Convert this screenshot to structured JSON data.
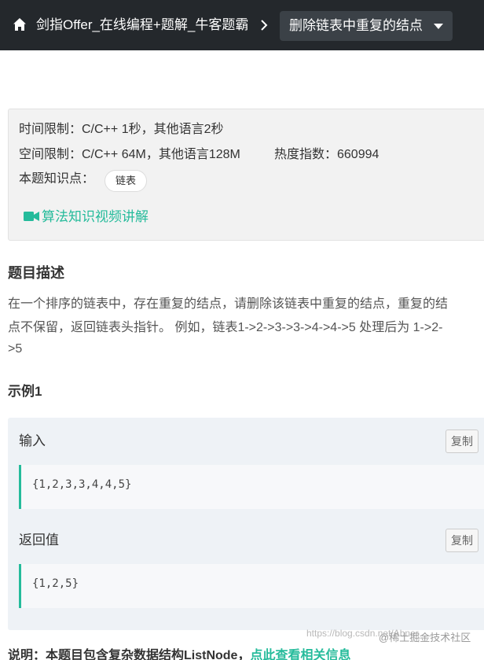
{
  "header": {
    "breadcrumb_link": "剑指Offer_在线编程+题解_牛客题霸",
    "current_problem": "删除链表中重复的结点"
  },
  "info": {
    "time_limit": "时间限制：C/C++ 1秒，其他语言2秒",
    "space_limit": "空间限制：C/C++ 64M，其他语言128M",
    "heat_index": "热度指数：660994",
    "knowledge_label": "本题知识点：",
    "knowledge_tag": "链表",
    "video_link": "算法知识视频讲解"
  },
  "description": {
    "title": "题目描述",
    "lines": [
      "在一个排序的链表中，存在重复的结点，请删除该链表中重复的结点，重复的结",
      "点不保留，返回链表头指针。 例如，链表1->2->3->3->4->4->5 处理后为 1->2-",
      ">5"
    ]
  },
  "example": {
    "title": "示例1",
    "input_label": "输入",
    "input_value": "{1,2,3,3,4,4,5}",
    "output_label": "返回值",
    "output_value": "{1,2,5}",
    "copy_label": "复制"
  },
  "note": {
    "prefix": "说明：本题目包含复杂数据结构ListNode，",
    "link": "点此查看相关信息"
  },
  "watermark": {
    "url": "https://blog.csdn.net/Abner_...",
    "brand": "@稀土掘金技术社区"
  },
  "colors": {
    "topbar": "#24282c",
    "accent": "#25bb9b"
  }
}
